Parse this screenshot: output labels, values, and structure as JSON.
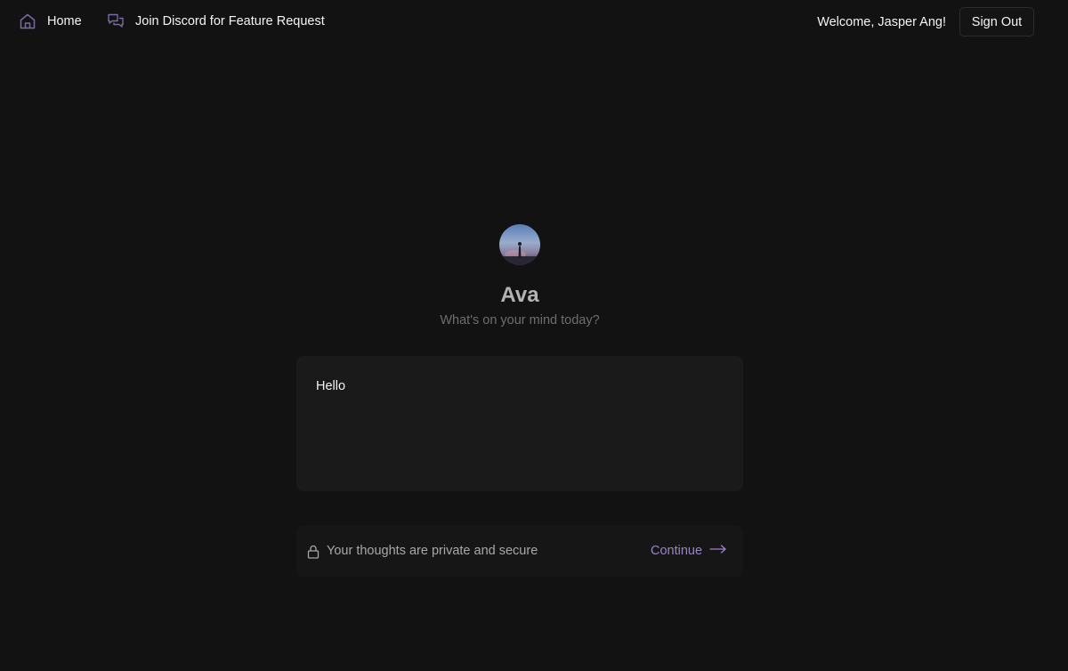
{
  "nav": {
    "home_label": "Home",
    "discord_label": "Join Discord for Feature Request",
    "welcome_text": "Welcome, Jasper Ang!",
    "signout_label": "Sign Out"
  },
  "persona": {
    "name": "Ava",
    "subtitle": "What's on your mind today?"
  },
  "entry": {
    "value": "Hello"
  },
  "footer": {
    "privacy_text": "Your thoughts are private and secure",
    "continue_label": "Continue"
  },
  "colors": {
    "background": "#121212",
    "accent": "#9b82c9",
    "panel": "#1a1a1a"
  },
  "icons": {
    "home": "home-icon",
    "discord": "chat-bubbles-icon",
    "lock": "lock-icon",
    "continue": "arrow-right-icon"
  }
}
